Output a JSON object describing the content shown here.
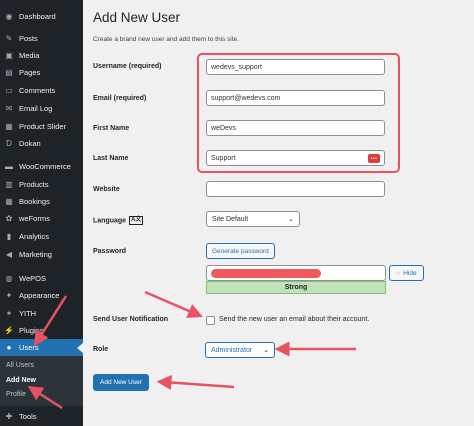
{
  "sidebar": {
    "items": [
      {
        "label": "Dashboard",
        "icon": "dashboard-icon",
        "glyph": "◉"
      },
      {
        "label": "Posts",
        "icon": "pin-icon",
        "glyph": "✎"
      },
      {
        "label": "Media",
        "icon": "media-icon",
        "glyph": "▣"
      },
      {
        "label": "Pages",
        "icon": "pages-icon",
        "glyph": "▤"
      },
      {
        "label": "Comments",
        "icon": "comments-icon",
        "glyph": "▭"
      },
      {
        "label": "Email Log",
        "icon": "email-icon",
        "glyph": "✉"
      },
      {
        "label": "Product Slider",
        "icon": "slider-icon",
        "glyph": "▦"
      },
      {
        "label": "Dokan",
        "icon": "dokan-icon",
        "glyph": "D"
      },
      {
        "label": "WooCommerce",
        "icon": "woocommerce-icon",
        "glyph": "▬"
      },
      {
        "label": "Products",
        "icon": "products-icon",
        "glyph": "▥"
      },
      {
        "label": "Bookings",
        "icon": "bookings-icon",
        "glyph": "▦"
      },
      {
        "label": "weForms",
        "icon": "weforms-icon",
        "glyph": "✿"
      },
      {
        "label": "Analytics",
        "icon": "analytics-icon",
        "glyph": "▮"
      },
      {
        "label": "Marketing",
        "icon": "marketing-icon",
        "glyph": "◀"
      },
      {
        "label": "WePOS",
        "icon": "wepos-icon",
        "glyph": "◍"
      },
      {
        "label": "Appearance",
        "icon": "appearance-icon",
        "glyph": "✦"
      },
      {
        "label": "YITH",
        "icon": "yith-icon",
        "glyph": "✶"
      },
      {
        "label": "Plugins",
        "icon": "plugins-icon",
        "glyph": "⚡"
      },
      {
        "label": "Users",
        "icon": "users-icon",
        "glyph": "●"
      },
      {
        "label": "Tools",
        "icon": "tools-icon",
        "glyph": "✚"
      }
    ],
    "submenu": [
      "All Users",
      "Add New",
      "Profile"
    ]
  },
  "page": {
    "title": "Add New User",
    "description": "Create a brand new user and add them to this site."
  },
  "form": {
    "username_label": "Username (required)",
    "username_value": "wedevs_support",
    "email_label": "Email (required)",
    "email_value": "support@wedevs.com",
    "first_name_label": "First Name",
    "first_name_value": "weDevs",
    "last_name_label": "Last Name",
    "last_name_value": "Support",
    "last_name_toggle": "•••",
    "website_label": "Website",
    "website_value": "",
    "language_label": "Language",
    "language_icon": "translate-icon",
    "language_icon_glyph": "A文",
    "language_value": "Site Default",
    "password_label": "Password",
    "generate_password": "Generate password",
    "hide_label": "Hide",
    "strength": "Strong",
    "notification_label": "Send User Notification",
    "notification_text": "Send the new user an email about their account.",
    "role_label": "Role",
    "role_value": "Administrator",
    "submit_label": "Add New User"
  },
  "colors": {
    "sidebar_bg": "#1d2327",
    "accent": "#2271b1",
    "highlight": "#e95262",
    "strength_bg": "#c1e1b9"
  }
}
